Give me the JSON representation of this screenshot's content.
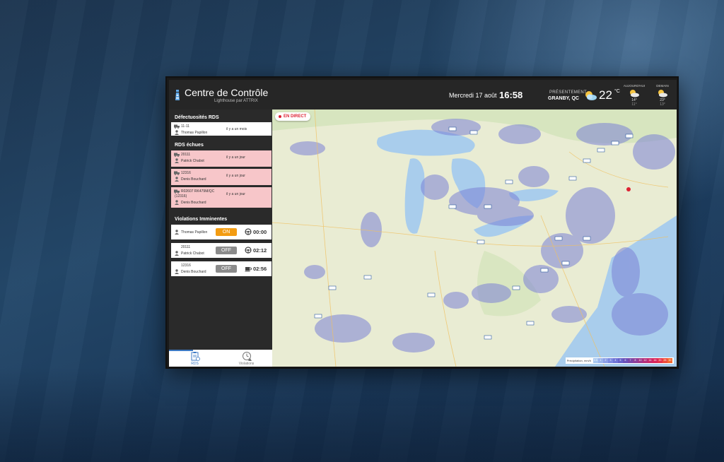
{
  "app": {
    "title": "Centre de Contrôle",
    "subtitle": "Lighthouse par ATTRIX"
  },
  "header": {
    "date": "Mercredi 17 août",
    "time": "16:58",
    "weather": {
      "now_label": "PRÉSENTEMENT",
      "city": "GRANBY, QC",
      "temp": "22",
      "unit": "°C",
      "icon": "partly-cloudy-icon"
    },
    "forecast": [
      {
        "label": "AUJOURD'HUI",
        "hi": "14°",
        "lo": "11°",
        "icon": "partly-cloudy-icon"
      },
      {
        "label": "DEMAIN",
        "hi": "23°",
        "lo": "13°",
        "icon": "partly-cloudy-icon"
      }
    ]
  },
  "sidebar": {
    "defects": {
      "heading": "Défectuosités RDS",
      "items": [
        {
          "line1": "11-11",
          "driver": "Thomas Papillon",
          "ago": "il y a un mois"
        }
      ]
    },
    "expired": {
      "heading": "RDS échues",
      "items": [
        {
          "line1": "20111",
          "driver": "Patrick Chabot",
          "ago": "il y a un jour"
        },
        {
          "line1": "12316",
          "driver": "Denis Bouchard",
          "ago": "il y a un jour"
        },
        {
          "line1": "R02607 RK479M/QC",
          "line2": "(12316)",
          "driver": "Denis Bouchard",
          "ago": "il y a un jour"
        }
      ]
    },
    "violations": {
      "heading": "Violations Imminentes",
      "items": [
        {
          "line1": "",
          "driver": "Thomas Papillon",
          "status": "ON",
          "icon": "steering-wheel-icon",
          "timer": "00:00"
        },
        {
          "line1": "20111",
          "driver": "Patrick Chabot",
          "status": "OFF",
          "icon": "steering-wheel-icon",
          "timer": "02:12"
        },
        {
          "line1": "12316",
          "driver": "Denis Bouchard",
          "status": "OFF",
          "icon": "coffee-cup-icon",
          "timer": "02:56"
        }
      ]
    },
    "tabs": [
      {
        "label": "RDS",
        "icon": "clipboard-icon",
        "active": true
      },
      {
        "label": "Violations",
        "icon": "clock-warning-icon",
        "active": false
      }
    ]
  },
  "map": {
    "live_label": "EN DIRECT",
    "legend_title": "Précipitation, mm/h",
    "legend_values": [
      "0.5",
      "1",
      "2",
      "3",
      "4",
      "5",
      "6",
      "7",
      "8",
      "10",
      "12",
      "14",
      "16",
      "20",
      "25",
      "30"
    ],
    "colors": {
      "water": "#a9cdec",
      "land": "#e9ecd3",
      "radar": "#7b82d6",
      "accent": "#3d7ac4",
      "on": "#f39c12",
      "off": "#8b8b8b",
      "expired": "#f7c6c9"
    }
  }
}
